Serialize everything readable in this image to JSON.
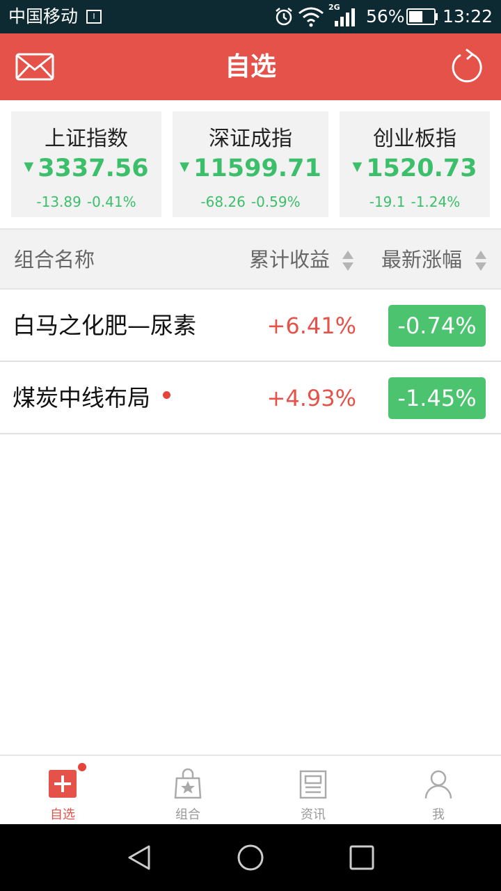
{
  "status_bar": {
    "carrier": "中国移动",
    "sim_icon": "sim-card-icon",
    "network_type": "2G",
    "battery_percent": "56%",
    "battery_level": 0.56,
    "time": "13:22"
  },
  "header": {
    "title": "自选",
    "left_icon": "mail-icon",
    "right_icon": "refresh-icon",
    "accent_color": "#e5524a"
  },
  "indices": [
    {
      "name": "上证指数",
      "price": "3337.56",
      "change": "-13.89",
      "change_pct": "-0.41%",
      "direction": "down"
    },
    {
      "name": "深证成指",
      "price": "11599.71",
      "change": "-68.26",
      "change_pct": "-0.59%",
      "direction": "down"
    },
    {
      "name": "创业板指",
      "price": "1520.73",
      "change": "-19.1",
      "change_pct": "-1.24%",
      "direction": "down"
    }
  ],
  "table": {
    "headers": {
      "name": "组合名称",
      "total_return": "累计收益",
      "latest_change": "最新涨幅"
    },
    "rows": [
      {
        "name": "白马之化肥—尿素",
        "total_return": "+6.41%",
        "latest_change": "-0.74%",
        "has_dot": false
      },
      {
        "name": "煤炭中线布局",
        "total_return": "+4.93%",
        "latest_change": "-1.45%",
        "has_dot": true
      }
    ]
  },
  "tabs": [
    {
      "label": "自选",
      "icon": "plus-square-icon",
      "active": true,
      "badge": true
    },
    {
      "label": "组合",
      "icon": "star-bag-icon",
      "active": false
    },
    {
      "label": "资讯",
      "icon": "news-icon",
      "active": false
    },
    {
      "label": "我",
      "icon": "person-icon",
      "active": false
    }
  ],
  "colors": {
    "up": "#e5524a",
    "down": "#3cbf6a",
    "badge_green": "#4cc46f"
  }
}
